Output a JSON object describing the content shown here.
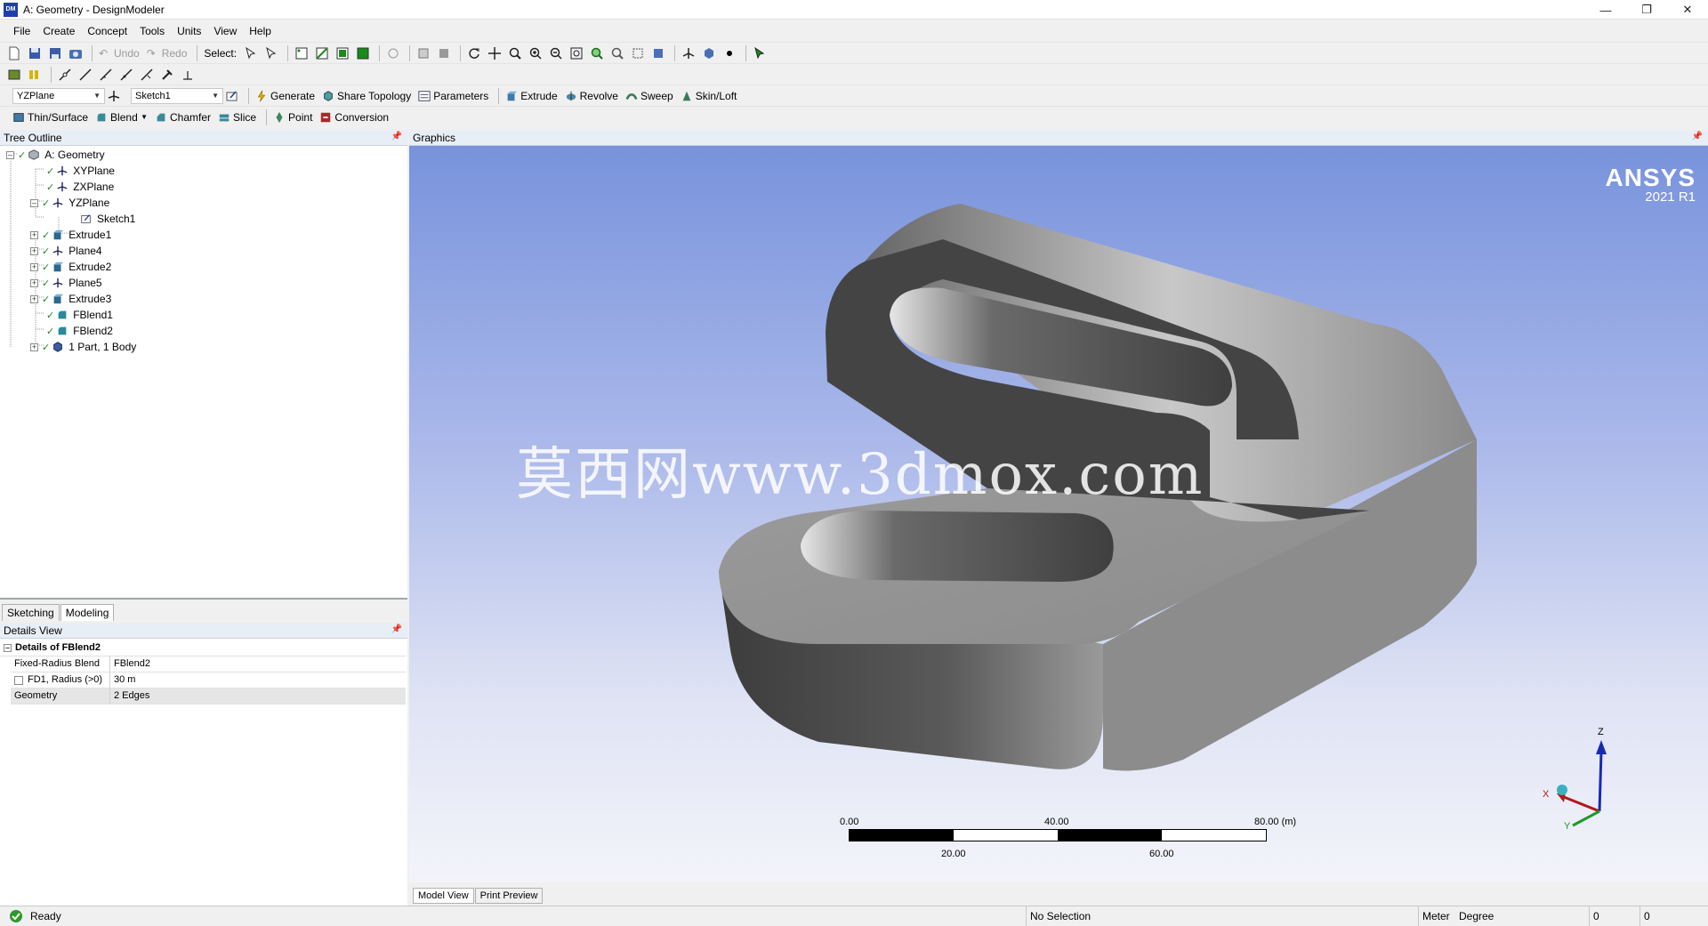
{
  "window": {
    "title": "A: Geometry - DesignModeler",
    "icon_text": "DM"
  },
  "menu": [
    "File",
    "Create",
    "Concept",
    "Tools",
    "Units",
    "View",
    "Help"
  ],
  "toolbar1": {
    "undo": "Undo",
    "redo": "Redo",
    "select_label": "Select:"
  },
  "toolbar3": {
    "plane_combo": "YZPlane",
    "sketch_combo": "Sketch1",
    "generate": "Generate",
    "share_topology": "Share Topology",
    "parameters": "Parameters",
    "extrude": "Extrude",
    "revolve": "Revolve",
    "sweep": "Sweep",
    "skin_loft": "Skin/Loft"
  },
  "toolbar4": {
    "thin_surface": "Thin/Surface",
    "blend": "Blend",
    "chamfer": "Chamfer",
    "slice": "Slice",
    "point": "Point",
    "conversion": "Conversion"
  },
  "tree_outline": {
    "header": "Tree Outline",
    "items": [
      {
        "label": "A: Geometry",
        "icon": "geometry-icon"
      },
      {
        "label": "XYPlane",
        "icon": "plane-icon"
      },
      {
        "label": "ZXPlane",
        "icon": "plane-icon"
      },
      {
        "label": "YZPlane",
        "icon": "plane-icon"
      },
      {
        "label": "Sketch1",
        "icon": "sketch-icon"
      },
      {
        "label": "Extrude1",
        "icon": "extrude-icon"
      },
      {
        "label": "Plane4",
        "icon": "plane-icon"
      },
      {
        "label": "Extrude2",
        "icon": "extrude-icon"
      },
      {
        "label": "Plane5",
        "icon": "plane-icon"
      },
      {
        "label": "Extrude3",
        "icon": "extrude-icon"
      },
      {
        "label": "FBlend1",
        "icon": "blend-icon"
      },
      {
        "label": "FBlend2",
        "icon": "blend-icon"
      },
      {
        "label": "1 Part, 1 Body",
        "icon": "body-icon"
      }
    ]
  },
  "panel_tabs": [
    "Sketching",
    "Modeling"
  ],
  "details_view": {
    "header": "Details View",
    "title": "Details of FBlend2",
    "rows": [
      {
        "name": "Fixed-Radius Blend",
        "value": "FBlend2"
      },
      {
        "name": "FD1, Radius (>0)",
        "value": "30 m"
      },
      {
        "name": "Geometry",
        "value": "2 Edges"
      }
    ]
  },
  "graphics": {
    "header": "Graphics",
    "logo_brand": "ANSYS",
    "logo_version": "2021 R1",
    "watermark": "莫西网www.3dmox.com",
    "scale": {
      "top_labels": [
        "0.00",
        "40.00",
        "80.00 (m)"
      ],
      "bottom_labels": [
        "20.00",
        "60.00"
      ]
    },
    "triad": {
      "x": "X",
      "y": "Y",
      "z": "Z"
    }
  },
  "view_tabs": [
    "Model View",
    "Print Preview"
  ],
  "status": {
    "ready": "Ready",
    "selection": "No Selection",
    "units_length": "Meter",
    "units_angle": "Degree",
    "field1": "0",
    "field2": "0"
  },
  "colors": {
    "accent": "#1f3fa8",
    "viewport_top": "#7893dc",
    "viewport_bottom": "#f3f4fa"
  }
}
